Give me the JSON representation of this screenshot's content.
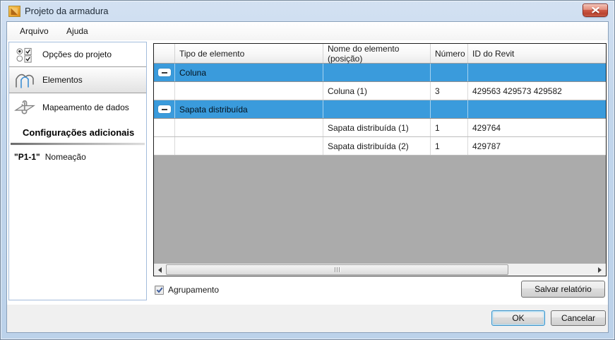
{
  "window": {
    "title": "Projeto da armadura"
  },
  "menu": {
    "items": [
      "Arquivo",
      "Ajuda"
    ]
  },
  "sidebar": {
    "items": [
      {
        "label": "Opções do projeto"
      },
      {
        "label": "Elementos"
      },
      {
        "label": "Mapeamento de dados"
      }
    ],
    "selected_item": "Elementos",
    "section_header": "Configurações adicionais",
    "naming": {
      "prefix": "\"P1-1\"",
      "label": "Nomeação"
    }
  },
  "table": {
    "columns": [
      "",
      "Tipo de elemento",
      "Nome do elemento (posição)",
      "Número",
      "ID do Revit"
    ],
    "rows": [
      {
        "type": "group",
        "label": "Coluna"
      },
      {
        "type": "item",
        "name": "Coluna (1)",
        "number": "3",
        "revit_id": "429563 429573 429582"
      },
      {
        "type": "group",
        "label": "Sapata distribuída"
      },
      {
        "type": "item",
        "name": "Sapata distribuída (1)",
        "number": "1",
        "revit_id": "429764"
      },
      {
        "type": "item",
        "name": "Sapata distribuída (2)",
        "number": "1",
        "revit_id": "429787"
      }
    ]
  },
  "footer": {
    "grouping": {
      "label": "Agrupamento",
      "checked": true
    },
    "save_report": "Salvar relatório",
    "ok": "OK",
    "cancel": "Cancelar"
  },
  "icons": {
    "window_icon": "app-logo",
    "close": "close-x",
    "collapse": "minus-box",
    "options_item": "radio-checkbox-group",
    "elements_item": "frame-structure",
    "mapping_item": "clip-through-plane",
    "checkbox_check": "check-mark",
    "scroll_left": "triangle-left",
    "scroll_right": "triangle-right"
  },
  "colors": {
    "group_row_blue": "#3A9BDC",
    "titlebar_blue": "#C2D6EC",
    "close_red": "#BA4531",
    "table_empty_gray": "#ABABAB",
    "ok_focus_border": "#3C93C9"
  }
}
